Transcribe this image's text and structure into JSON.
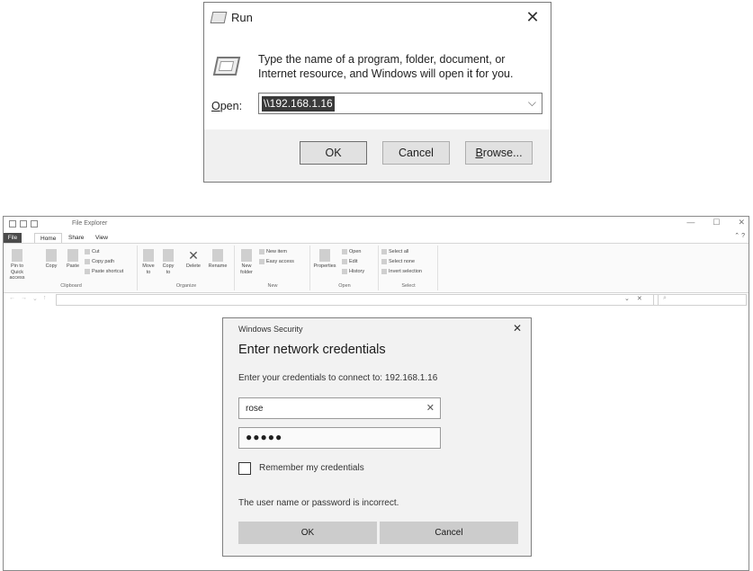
{
  "run": {
    "title": "Run",
    "description": "Type the name of a program, folder, document, or Internet resource, and Windows will open it for you.",
    "open_label_underlined": "O",
    "open_label_rest": "pen:",
    "open_value": "\\\\192.168.1.16",
    "ok_label": "OK",
    "cancel_label": "Cancel",
    "browse_underlined": "B",
    "browse_rest": "rowse..."
  },
  "explorer": {
    "title": "File Explorer",
    "tabs": {
      "file": "File",
      "home": "Home",
      "share": "Share",
      "view": "View"
    },
    "ribbon": {
      "clipboard": {
        "label": "Clipboard",
        "pin": "Pin to Quick access",
        "copy": "Copy",
        "paste": "Paste",
        "cut": "Cut",
        "copy_path": "Copy path",
        "paste_shortcut": "Paste shortcut"
      },
      "organize": {
        "label": "Organize",
        "move_to": "Move to",
        "copy_to": "Copy to",
        "delete": "Delete",
        "rename": "Rename"
      },
      "new": {
        "label": "New",
        "new_folder": "New folder",
        "new_item": "New item",
        "easy_access": "Easy access"
      },
      "open": {
        "label": "Open",
        "properties": "Properties",
        "open": "Open",
        "edit": "Edit",
        "history": "History"
      },
      "select": {
        "label": "Select",
        "select_all": "Select all",
        "select_none": "Select none",
        "invert_selection": "Invert selection"
      }
    }
  },
  "security": {
    "caption": "Windows Security",
    "heading": "Enter network credentials",
    "prompt": "Enter your credentials to connect to: 192.168.1.16",
    "username": "rose",
    "password_mask": "●●●●●",
    "remember_label": "Remember my credentials",
    "error": "The user name or password is incorrect.",
    "ok_label": "OK",
    "cancel_label": "Cancel"
  }
}
